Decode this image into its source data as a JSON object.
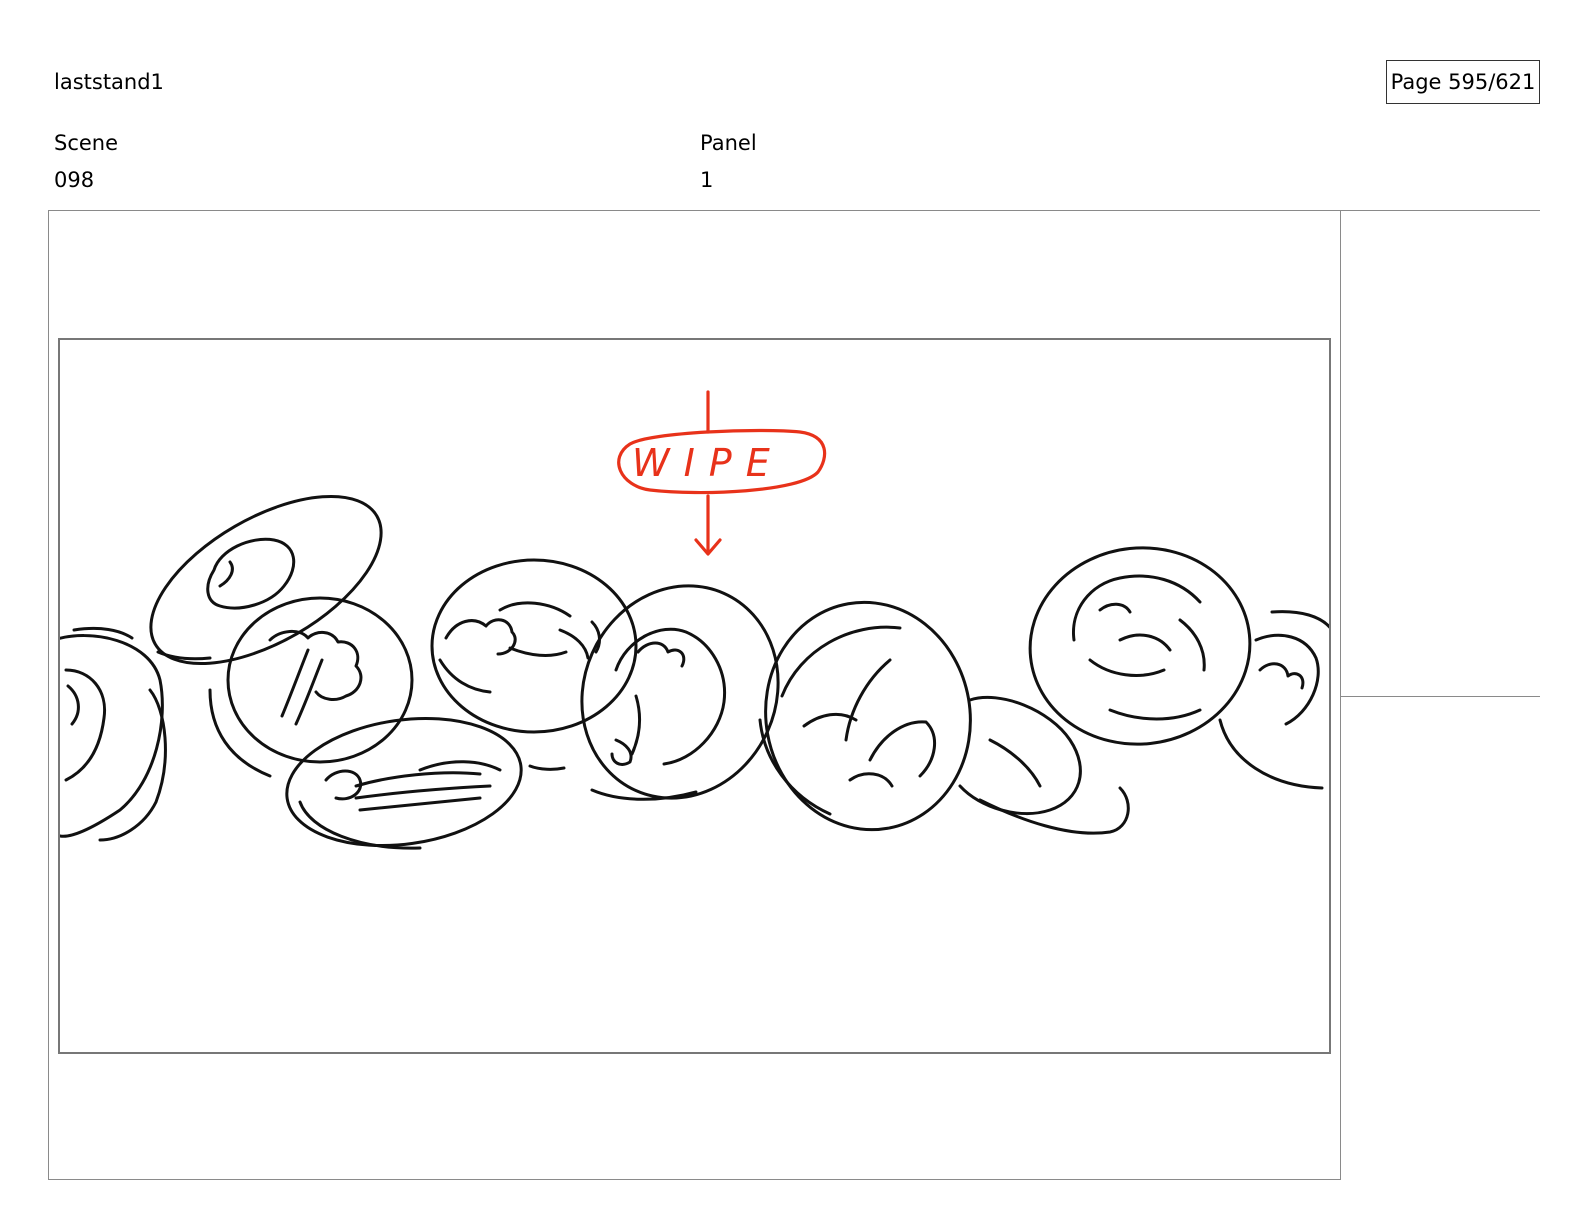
{
  "header": {
    "project_title": "laststand1",
    "page_indicator": "Page 595/621"
  },
  "fields": {
    "scene_label": "Scene",
    "scene_value": "098",
    "panel_label": "Panel",
    "panel_value": "1"
  },
  "drawing": {
    "annotation_text": "WIPE",
    "annotation_color": "#e8321a",
    "line_color": "#111111",
    "icon": "storyboard-sketch-coins"
  }
}
